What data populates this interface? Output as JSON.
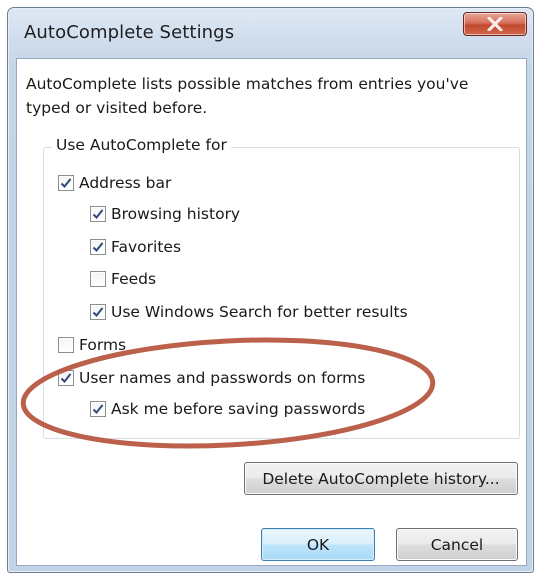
{
  "window": {
    "title": "AutoComplete Settings",
    "close_icon": "close-x-icon",
    "close_button_color": "#c75237"
  },
  "description": "AutoComplete lists possible matches from entries you've typed or visited before.",
  "group": {
    "legend": "Use AutoComplete for",
    "options": [
      {
        "label": "Address bar",
        "checked": true
      },
      {
        "label": "Browsing history",
        "checked": true
      },
      {
        "label": "Favorites",
        "checked": true
      },
      {
        "label": "Feeds",
        "checked": false
      },
      {
        "label": "Use Windows Search for better results",
        "checked": true
      },
      {
        "label": "Forms",
        "checked": false
      },
      {
        "label": "User names and passwords on forms",
        "checked": true
      },
      {
        "label": "Ask me before saving passwords",
        "checked": true
      }
    ]
  },
  "buttons": {
    "delete_history": "Delete AutoComplete history...",
    "ok": "OK",
    "cancel": "Cancel"
  },
  "annotation": {
    "ellipse_color": "#b5533c"
  }
}
